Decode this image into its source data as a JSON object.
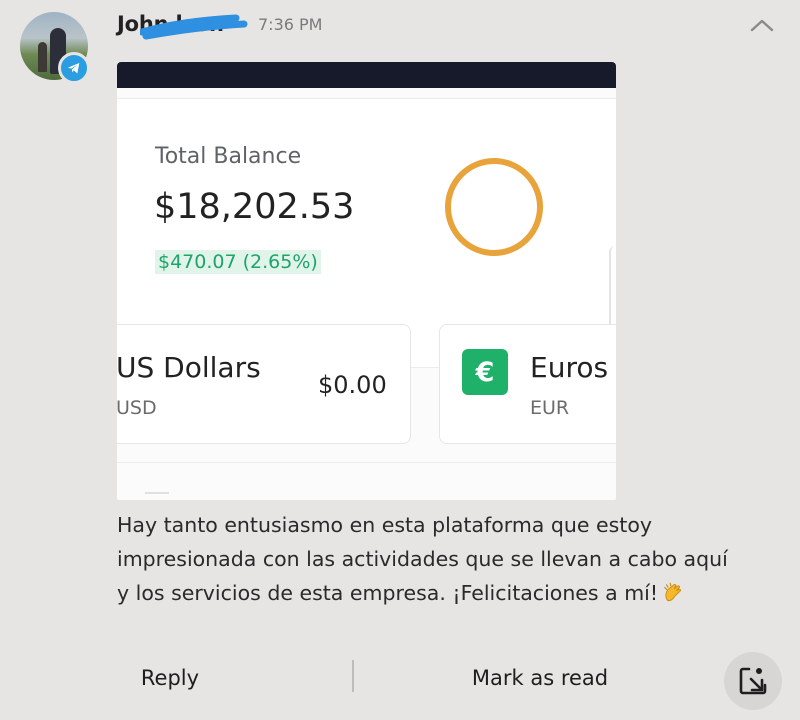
{
  "notification": {
    "sender": "John   lson",
    "time": "7:36 PM",
    "app_badge_icon": "telegram-icon",
    "collapse_icon": "chevron-up-icon"
  },
  "attached_screenshot": {
    "balance_label": "Total Balance",
    "balance_value": "$18,202.53",
    "balance_change": "$470.07 (2.65%)",
    "change_color": "#20a36a",
    "ring_color": "#e8a33a",
    "currencies": [
      {
        "name": "US Dollars",
        "code": "USD",
        "amount": "$0.00"
      },
      {
        "name": "Euros",
        "code": "EUR",
        "symbol": "€",
        "icon_color": "#1fb06a"
      }
    ]
  },
  "message": {
    "lines": [
      "Hay tanto entusiasmo en esta plataforma que estoy",
      "impresionada con las actividades que se llevan a cabo aquí",
      "y los servicios de esta empresa. ¡Felicitaciones a mí!"
    ],
    "emoji_icon": "clapping-hands-icon"
  },
  "actions": {
    "reply_label": "Reply",
    "mark_read_label": "Mark as read",
    "open_icon": "open-in-app-icon"
  }
}
